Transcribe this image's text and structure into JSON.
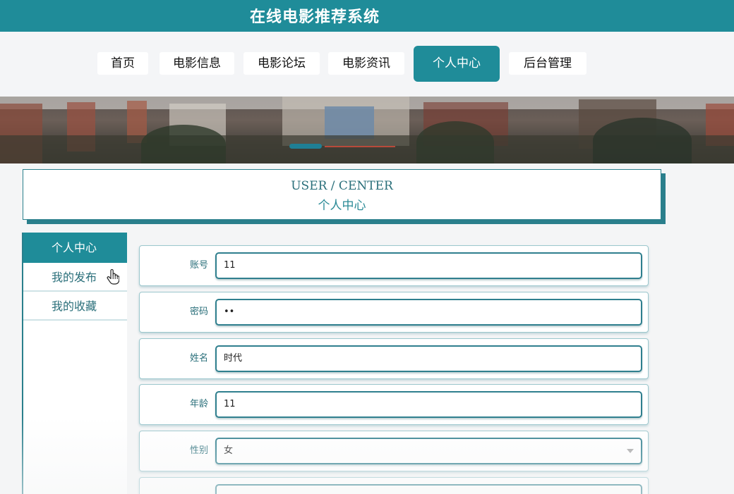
{
  "header": {
    "site_title": "在线电影推荐系统"
  },
  "nav": {
    "items": [
      {
        "label": "首页",
        "active": false
      },
      {
        "label": "电影信息",
        "active": false
      },
      {
        "label": "电影论坛",
        "active": false
      },
      {
        "label": "电影资讯",
        "active": false
      },
      {
        "label": "个人中心",
        "active": true
      },
      {
        "label": "后台管理",
        "active": false
      }
    ]
  },
  "page_header": {
    "title_en": "USER / CENTER",
    "title_cn": "个人中心"
  },
  "sidebar": {
    "items": [
      {
        "label": "个人中心",
        "active": true
      },
      {
        "label": "我的发布",
        "active": false
      },
      {
        "label": "我的收藏",
        "active": false
      }
    ]
  },
  "form": {
    "fields": [
      {
        "label": "账号",
        "value": "11",
        "type": "text"
      },
      {
        "label": "密码",
        "value": "••",
        "type": "password"
      },
      {
        "label": "姓名",
        "value": "时代",
        "type": "text"
      },
      {
        "label": "年龄",
        "value": "11",
        "type": "text"
      },
      {
        "label": "性别",
        "value": "女",
        "type": "select"
      }
    ]
  },
  "colors": {
    "primary": "#1f8c99",
    "text_teal": "#2a6f7a",
    "border": "#2a7f8c"
  },
  "icons": {
    "cursor": "hand-pointer-icon",
    "select_caret": "chevron-down-icon"
  }
}
